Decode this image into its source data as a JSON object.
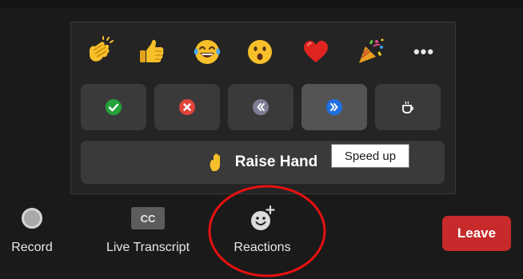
{
  "reactions_panel": {
    "emojis": [
      {
        "name": "clapping-hands",
        "glyph": "clapping hands"
      },
      {
        "name": "thumbs-up",
        "glyph": "thumbs up"
      },
      {
        "name": "tears-of-joy",
        "glyph": "face with tears of joy"
      },
      {
        "name": "open-mouth",
        "glyph": "face with open mouth"
      },
      {
        "name": "red-heart",
        "glyph": "red heart"
      },
      {
        "name": "party-popper",
        "glyph": "party popper"
      }
    ],
    "more_label": "•••",
    "status_buttons": [
      {
        "name": "yes",
        "icon": "check-icon",
        "color": "#23a33a"
      },
      {
        "name": "no",
        "icon": "x-icon",
        "color": "#e0443a"
      },
      {
        "name": "slow-down",
        "icon": "rewind-icon",
        "color": "#7d7d93"
      },
      {
        "name": "speed-up",
        "icon": "fast-forward-icon",
        "color": "#1f6fe0",
        "selected": true
      },
      {
        "name": "coffee",
        "icon": "coffee-icon",
        "color": "#ffffff"
      }
    ],
    "raise_hand_label": "Raise Hand",
    "tooltip": "Speed up"
  },
  "toolbar": {
    "record_label": "Record",
    "transcript_icon_text": "CC",
    "transcript_label": "Live Transcript",
    "reactions_label": "Reactions",
    "leave_label": "Leave"
  },
  "colors": {
    "panel_bg": "#242424",
    "button_bg": "#3a3a3a",
    "leave_red": "#c72a2a",
    "annotation_red": "#e81010"
  }
}
